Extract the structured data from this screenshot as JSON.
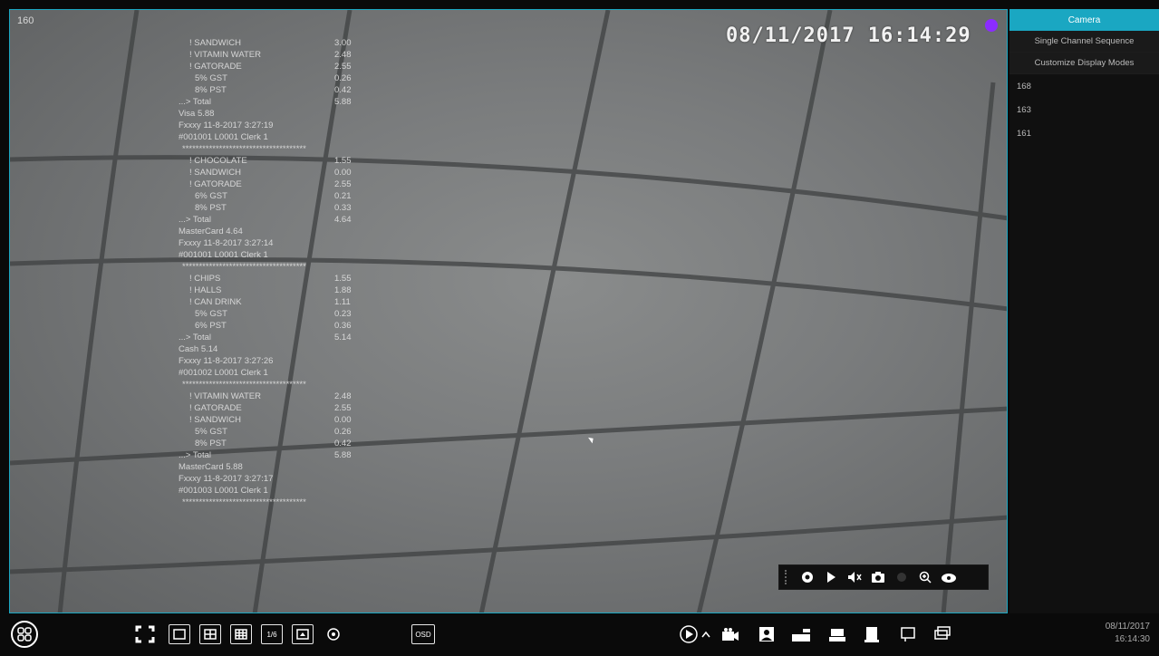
{
  "video": {
    "channel_label": "160",
    "osd_datetime": "08/11/2017  16:14:29",
    "receipt_lines": [
      {
        "label": "! SANDWICH",
        "amount": "3.00",
        "indent": 1
      },
      {
        "label": "! VITAMIN WATER",
        "amount": "2.48",
        "indent": 1
      },
      {
        "label": "! GATORADE",
        "amount": "2.55",
        "indent": 1
      },
      {
        "label": "5% GST",
        "amount": "0.26",
        "indent": 2
      },
      {
        "label": "8% PST",
        "amount": "0.42",
        "indent": 2
      },
      {
        "label": "...> Total",
        "amount": "5.88",
        "indent": 0
      },
      {
        "label": "Visa        5.88",
        "amount": "",
        "indent": 0
      },
      {
        "label": "Fxxxy   11-8-2017 3:27:19",
        "amount": "",
        "indent": 0
      },
      {
        "label": "#001001 L0001 Clerk 1",
        "amount": "",
        "indent": 0
      },
      {
        "label": "*************************************",
        "amount": "",
        "indent": -1
      },
      {
        "label": "! CHOCOLATE",
        "amount": "1.55",
        "indent": 1
      },
      {
        "label": "! SANDWICH",
        "amount": "0.00",
        "indent": 1
      },
      {
        "label": "! GATORADE",
        "amount": "2.55",
        "indent": 1
      },
      {
        "label": "6% GST",
        "amount": "0.21",
        "indent": 2
      },
      {
        "label": "8% PST",
        "amount": "0.33",
        "indent": 2
      },
      {
        "label": "...> Total",
        "amount": "4.64",
        "indent": 0
      },
      {
        "label": "MasterCard     4.64",
        "amount": "",
        "indent": 0
      },
      {
        "label": "Fxxxy   11-8-2017 3:27:14",
        "amount": "",
        "indent": 0
      },
      {
        "label": "#001001 L0001 Clerk 1",
        "amount": "",
        "indent": 0
      },
      {
        "label": "*************************************",
        "amount": "",
        "indent": -1
      },
      {
        "label": "! CHIPS",
        "amount": "1.55",
        "indent": 1
      },
      {
        "label": "! HALLS",
        "amount": "1.88",
        "indent": 1
      },
      {
        "label": "! CAN DRINK",
        "amount": "1.11",
        "indent": 1
      },
      {
        "label": "5% GST",
        "amount": "0.23",
        "indent": 2
      },
      {
        "label": "6% PST",
        "amount": "0.36",
        "indent": 2
      },
      {
        "label": "...> Total",
        "amount": "5.14",
        "indent": 0
      },
      {
        "label": "Cash       5.14",
        "amount": "",
        "indent": 0
      },
      {
        "label": "Fxxxy   11-8-2017 3:27:26",
        "amount": "",
        "indent": 0
      },
      {
        "label": "#001002 L0001 Clerk 1",
        "amount": "",
        "indent": 0
      },
      {
        "label": "*************************************",
        "amount": "",
        "indent": -1
      },
      {
        "label": "! VITAMIN WATER",
        "amount": "2.48",
        "indent": 1
      },
      {
        "label": "! GATORADE",
        "amount": "2.55",
        "indent": 1
      },
      {
        "label": "! SANDWICH",
        "amount": "0.00",
        "indent": 1
      },
      {
        "label": "5% GST",
        "amount": "0.26",
        "indent": 2
      },
      {
        "label": "8% PST",
        "amount": "0.42",
        "indent": 2
      },
      {
        "label": "...> Total",
        "amount": "5.88",
        "indent": 0
      },
      {
        "label": "MasterCard     5.88",
        "amount": "",
        "indent": 0
      },
      {
        "label": "Fxxxy   11-8-2017 3:27:17",
        "amount": "",
        "indent": 0
      },
      {
        "label": "#001003 L0001 Clerk 1",
        "amount": "",
        "indent": 0
      },
      {
        "label": "*************************************",
        "amount": "",
        "indent": -1
      }
    ],
    "mini_toolbar_icons": [
      "drag-handle-icon",
      "record-icon",
      "play-icon",
      "volume-icon",
      "snapshot-icon",
      "disabled-dot-icon",
      "zoom-icon",
      "ptz-icon"
    ]
  },
  "side_panel": {
    "header": "Camera",
    "tabs": [
      "Single Channel Sequence",
      "Customize Display Modes"
    ],
    "items": [
      "168",
      "163",
      "161"
    ]
  },
  "toolbar": {
    "osd_label": "OSD",
    "layout_label": "1/6",
    "clock_date": "08/11/2017",
    "clock_time": "16:14:30"
  },
  "colors": {
    "accent": "#1aa7c2",
    "record_dot": "#8b2cff"
  }
}
